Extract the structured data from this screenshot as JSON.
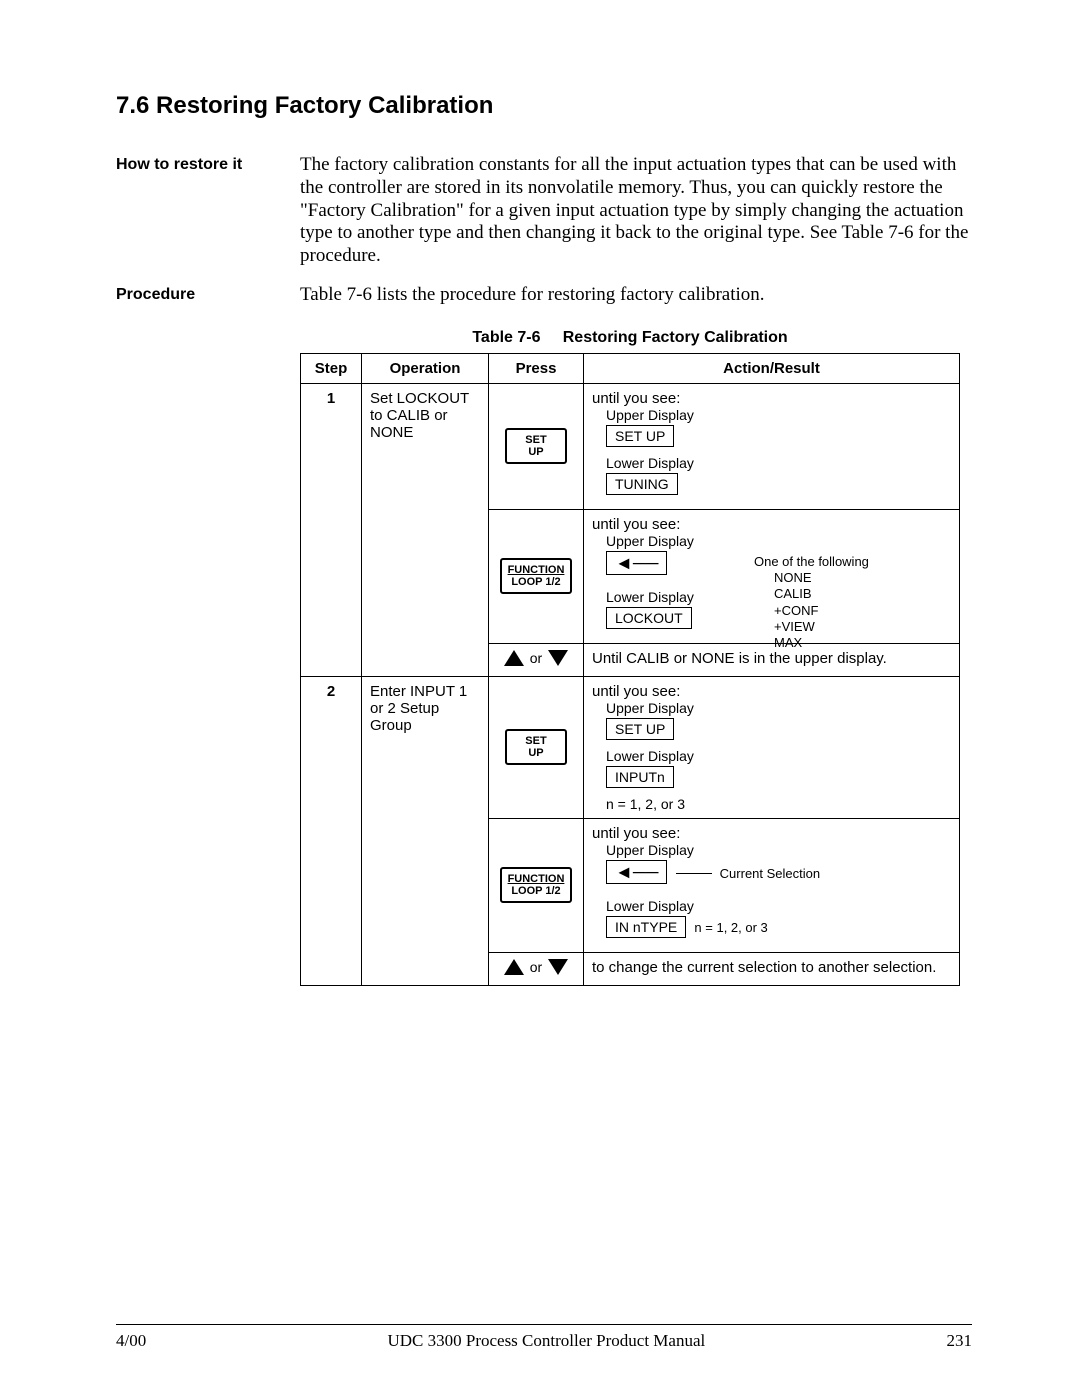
{
  "heading": "7.6  Restoring Factory Calibration",
  "sections": {
    "howto": {
      "label": "How to restore it",
      "text": "The factory calibration constants for all the input actuation types that can be used with the controller are stored in its nonvolatile memory. Thus, you can quickly restore the \"Factory Calibration\" for a given input actuation type by simply changing the actuation type to another type and then changing it back to the original type. See Table 7-6 for the procedure."
    },
    "procedure": {
      "label": "Procedure",
      "text": "Table 7-6 lists the procedure for restoring factory calibration."
    }
  },
  "table_caption_label": "Table 7-6",
  "table_caption_title": "Restoring Factory Calibration",
  "columns": {
    "c1": "Step",
    "c2": "Operation",
    "c3": "Press",
    "c4": "Action/Result"
  },
  "keys": {
    "setup_l1": "SET",
    "setup_l2": "UP",
    "func_l1": "FUNCTION",
    "func_l2": "LOOP 1/2"
  },
  "labels": {
    "until": "until you see:",
    "upper": "Upper Display",
    "lower": "Lower Display",
    "or": "or"
  },
  "step1": {
    "num": "1",
    "operation": "Set LOCKOUT to CALIB or NONE",
    "r1": {
      "upper_box": "SET UP",
      "lower_box": "TUNING"
    },
    "r2": {
      "lower_box": "LOCKOUT",
      "options_intro": "One of the following",
      "opt1": "NONE",
      "opt2": "CALIB",
      "opt3": "+CONF",
      "opt4": "+VIEW",
      "opt5": "MAX"
    },
    "r3": {
      "text": "Until CALIB or NONE is in the upper display."
    }
  },
  "step2": {
    "num": "2",
    "operation": "Enter INPUT 1 or 2 Setup Group",
    "r1": {
      "upper_box": "SET UP",
      "lower_box": "INPUTn",
      "note": "n = 1, 2, or 3"
    },
    "r2": {
      "lower_box": "IN nTYPE",
      "note": "n = 1, 2, or 3",
      "annot": "Current Selection"
    },
    "r3": {
      "text": "to change the current selection to another selection."
    }
  },
  "footer": {
    "left": "4/00",
    "center": "UDC 3300 Process Controller Product Manual",
    "right": "231"
  }
}
